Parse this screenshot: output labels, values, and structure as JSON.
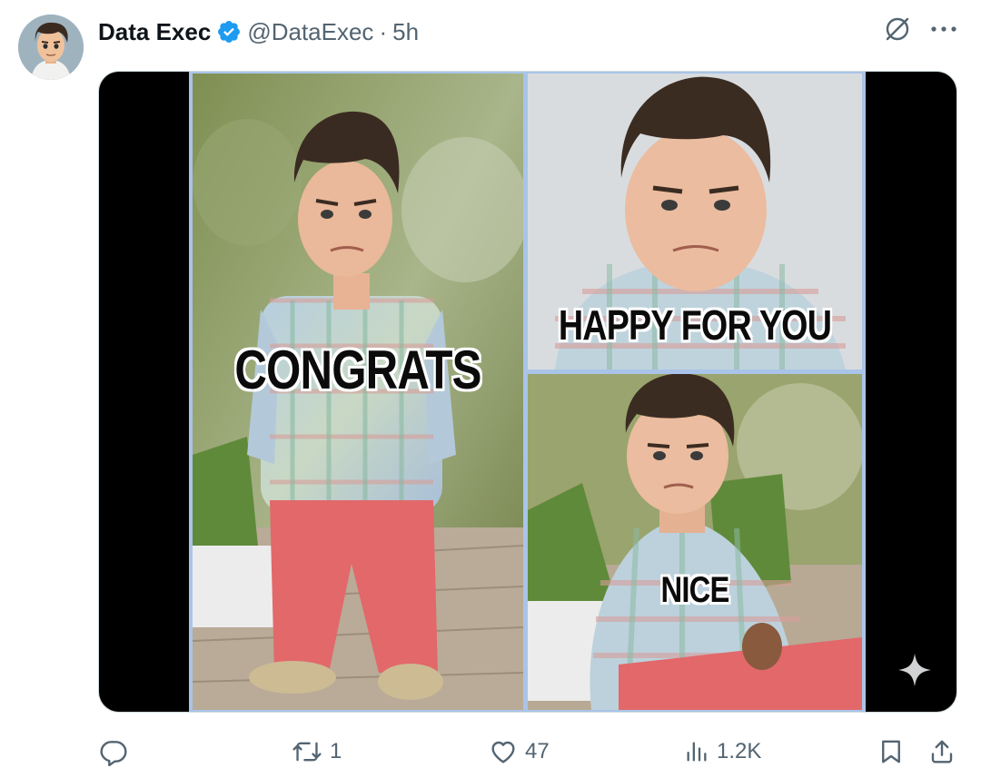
{
  "post": {
    "display_name": "Data Exec",
    "handle": "@DataExec",
    "separator": "·",
    "time": "5h",
    "verified": true,
    "avatar_icon": "cartoon-avatar"
  },
  "top_actions": {
    "grok_icon": "grok-icon",
    "more_icon": "more-icon"
  },
  "media": {
    "panels": [
      {
        "caption": "CONGRATS"
      },
      {
        "caption": "HAPPY FOR YOU"
      },
      {
        "caption": "NICE"
      }
    ],
    "badge_icon": "sparkle-icon"
  },
  "actions": {
    "reply": {
      "icon": "reply-icon",
      "count": ""
    },
    "repost": {
      "icon": "repost-icon",
      "count": "1"
    },
    "like": {
      "icon": "heart-icon",
      "count": "47"
    },
    "views": {
      "icon": "views-icon",
      "count": "1.2K"
    },
    "bookmark": {
      "icon": "bookmark-icon"
    },
    "share": {
      "icon": "share-icon"
    }
  },
  "colors": {
    "verified": "#1d9bf0",
    "text_secondary": "#536471",
    "panel_border": "#a9c4e8"
  }
}
